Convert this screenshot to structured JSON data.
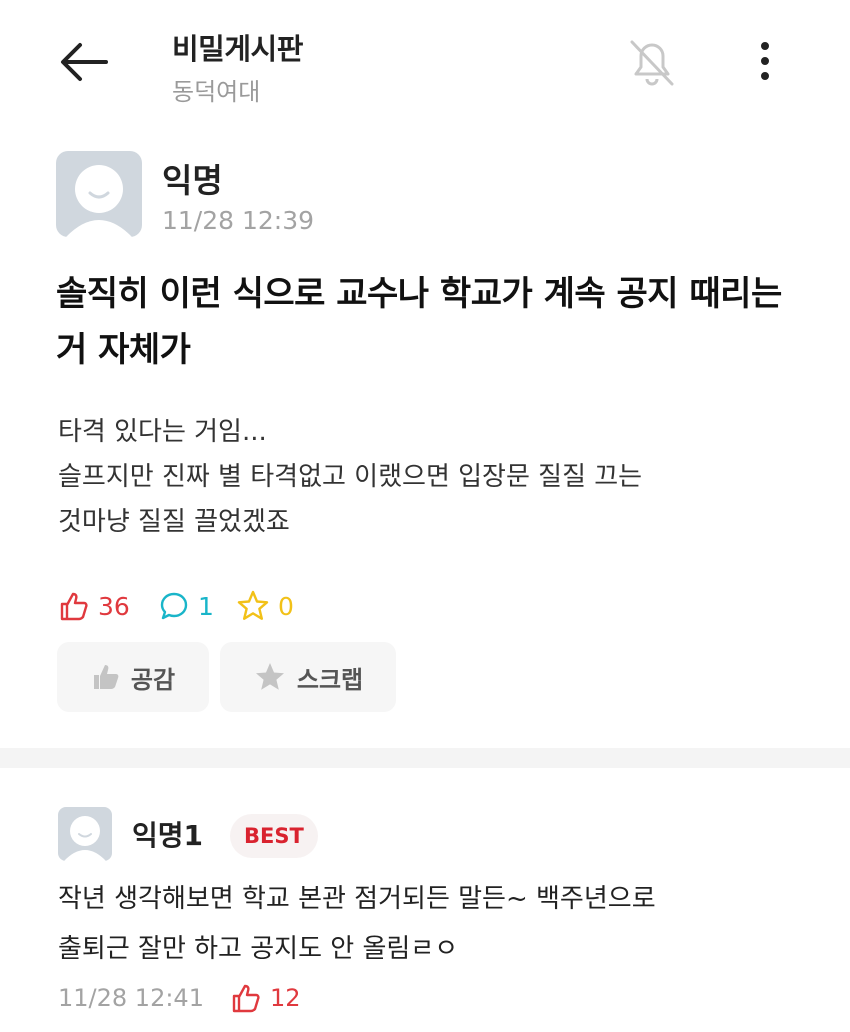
{
  "header": {
    "back_icon": "arrow-left-icon",
    "title": "비밀게시판",
    "subtitle": "동덕여대",
    "bell_icon": "bell-off-icon",
    "more_icon": "more-vertical-icon"
  },
  "post": {
    "author": "익명",
    "time": "11/28 12:39",
    "title": "솔직히 이런 식으로 교수나 학교가 계속 공지 때리는 거 자체가",
    "body_lines": [
      "타격 있다는 거임...",
      "슬프지만 진짜 별 타격없고 이랬으면 입장문 질질 끄는",
      "것마냥 질질 끌었겠죠"
    ],
    "stats": {
      "likes": "36",
      "comments": "1",
      "scraps": "0"
    },
    "actions": {
      "empathy_label": "공감",
      "scrap_label": "스크랩"
    }
  },
  "comment": {
    "author": "익명1",
    "badge": "BEST",
    "body_lines": [
      "작년 생각해보면 학교 본관 점거되든 말든~ 백주년으로",
      "출퇴근 잘만 하고 공지도 안 올림ㄹㅇ"
    ],
    "time": "11/28 12:41",
    "likes": "12"
  },
  "colors": {
    "like": "#e0393e",
    "comment": "#19b5c9",
    "scrap": "#f2c118",
    "badge_text": "#d9232f",
    "muted_text": "#a3a3a3"
  }
}
